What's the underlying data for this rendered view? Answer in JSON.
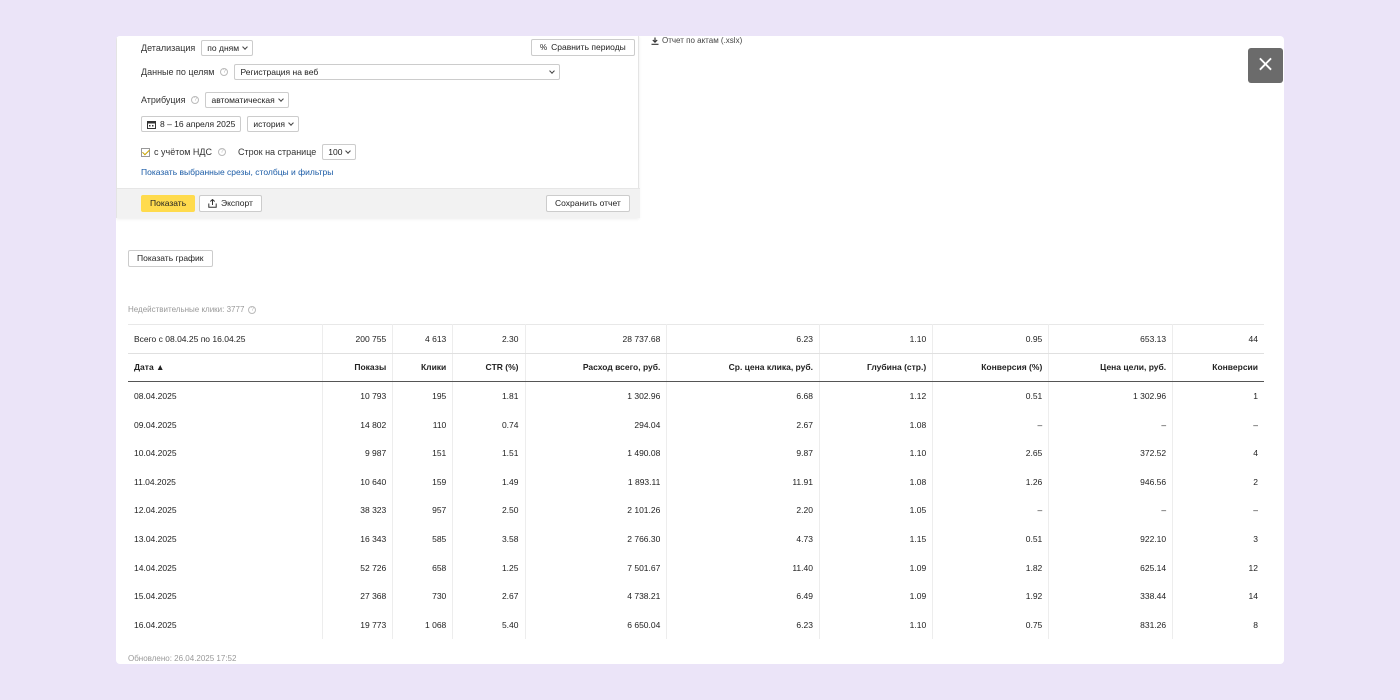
{
  "filters": {
    "detalization_label": "Детализация",
    "detalization_value": "по дням",
    "compare_label": "Сравнить периоды",
    "goals_label": "Данные по целям",
    "goals_value": "Регистрация на веб",
    "attribution_label": "Атрибуция",
    "attribution_value": "автоматическая",
    "date_range": "8 – 16 апреля 2025",
    "history_value": "история",
    "vat_label": "с учётом НДС",
    "rows_label": "Строк на странице",
    "rows_value": "100",
    "show_slices_link": "Показать выбранные срезы, столбцы и фильтры",
    "show_button": "Показать",
    "export_button": "Экспорт",
    "save_button": "Сохранить отчет"
  },
  "acts_report_link": "Отчет по актам (.xslx)",
  "close_icon": "×",
  "show_chart_button": "Показать график",
  "invalid_clicks": "Недействительные клики: 3777",
  "updated": "Обновлено: 26.04.2025 17:52",
  "table": {
    "total": [
      "Всего с 08.04.25 по 16.04.25",
      "200 755",
      "4 613",
      "2.30",
      "28 737.68",
      "6.23",
      "1.10",
      "0.95",
      "653.13",
      "44"
    ],
    "headers": [
      "Дата ▲",
      "Показы",
      "Клики",
      "CTR (%)",
      "Расход всего, руб.",
      "Ср. цена клика, руб.",
      "Глубина (стр.)",
      "Конверсия (%)",
      "Цена цели, руб.",
      "Конверсии"
    ],
    "rows": [
      [
        "08.04.2025",
        "10 793",
        "195",
        "1.81",
        "1 302.96",
        "6.68",
        "1.12",
        "0.51",
        "1 302.96",
        "1"
      ],
      [
        "09.04.2025",
        "14 802",
        "110",
        "0.74",
        "294.04",
        "2.67",
        "1.08",
        "–",
        "–",
        "–"
      ],
      [
        "10.04.2025",
        "9 987",
        "151",
        "1.51",
        "1 490.08",
        "9.87",
        "1.10",
        "2.65",
        "372.52",
        "4"
      ],
      [
        "11.04.2025",
        "10 640",
        "159",
        "1.49",
        "1 893.11",
        "11.91",
        "1.08",
        "1.26",
        "946.56",
        "2"
      ],
      [
        "12.04.2025",
        "38 323",
        "957",
        "2.50",
        "2 101.26",
        "2.20",
        "1.05",
        "–",
        "–",
        "–"
      ],
      [
        "13.04.2025",
        "16 343",
        "585",
        "3.58",
        "2 766.30",
        "4.73",
        "1.15",
        "0.51",
        "922.10",
        "3"
      ],
      [
        "14.04.2025",
        "52 726",
        "658",
        "1.25",
        "7 501.67",
        "11.40",
        "1.09",
        "1.82",
        "625.14",
        "12"
      ],
      [
        "15.04.2025",
        "27 368",
        "730",
        "2.67",
        "4 738.21",
        "6.49",
        "1.09",
        "1.92",
        "338.44",
        "14"
      ],
      [
        "16.04.2025",
        "19 773",
        "1 068",
        "5.40",
        "6 650.04",
        "6.23",
        "1.10",
        "0.75",
        "831.26",
        "8"
      ]
    ]
  },
  "colors": {
    "background": "#ebe4f8",
    "show_button": "#ffdb4d",
    "link": "#1a5ba6"
  }
}
